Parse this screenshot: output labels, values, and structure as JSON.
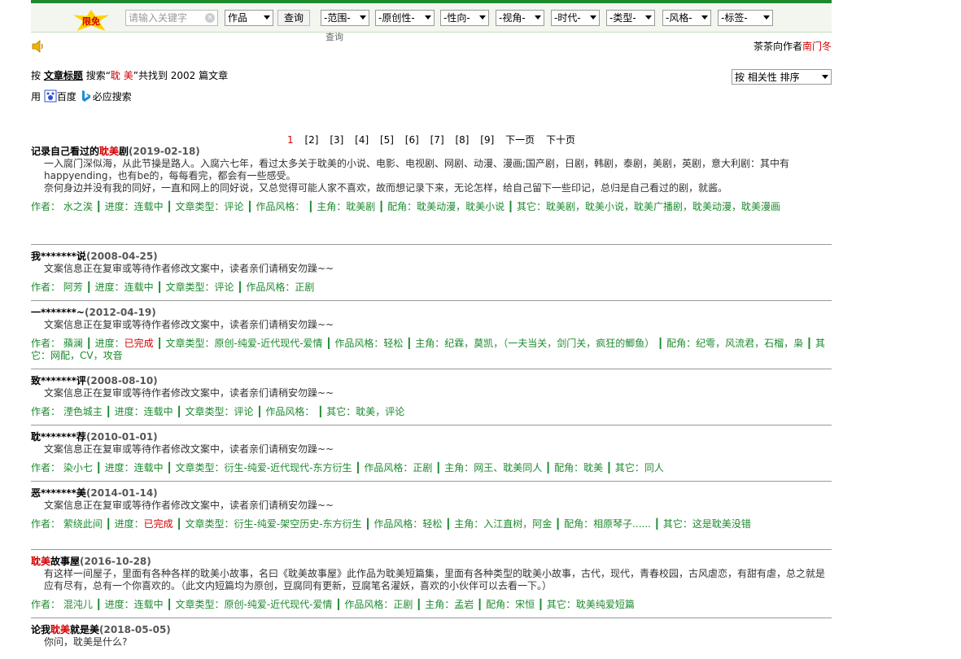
{
  "topbar": {
    "badge_text": "限免",
    "search_placeholder": "请输入关键字",
    "search_clear": "×",
    "type_select": "作品",
    "query_button": "查询",
    "query_label_below": "查询",
    "filters": [
      "-范围-",
      "-原创性-",
      "-性向-",
      "-视角-",
      "-时代-",
      "-类型-",
      "-风格-",
      "-标签-"
    ]
  },
  "author_line": {
    "prefix": "茶茶向作者",
    "name": "南门冬"
  },
  "search_info": {
    "p1": "按",
    "field": "文章标题",
    "p2": "搜索“",
    "keyword": "耽 美",
    "p3": "”共找到",
    "count": "2002",
    "p4": "篇文章"
  },
  "sort_select": "按 相关性 排序",
  "engines": {
    "prefix": "用",
    "baidu": "百度",
    "bing": "必应搜索"
  },
  "pager": {
    "current": "1",
    "pages": [
      "[2]",
      "[3]",
      "[4]",
      "[5]",
      "[6]",
      "[7]",
      "[8]",
      "[9]"
    ],
    "next": "下一页",
    "next10": "下十页"
  },
  "articles": [
    {
      "title_pre": "记录自己看过的",
      "title_hl": "耽美",
      "title_post": "剧",
      "date": "(2019-02-18)",
      "desc": [
        "一入腐门深似海，从此节操是路人。入腐六七年，看过太多关于耽美的小说、电影、电视剧、网剧、动漫、漫画;国产剧，日剧，韩剧，泰剧，美剧，英剧，意大利剧：其中有happyending，也有be的，每每看完，都会有一些感受。",
        "奈何身边并没有我的同好，一直和网上的同好说，又总觉得可能人家不喜欢，故而想记录下来，无论怎样，给自己留下一些印记，总归是自己看过的剧，就酱。"
      ],
      "meta": "作者： 水之涘  ┃ 进度：连载中  ┃ 文章类型：评论  ┃ 作品风格：  ┃ 主角：耽美剧  ┃ 配角：耽美动漫，耽美小说  ┃ 其它：耽美剧，耽美小说，耽美广播剧，耽美动漫，耽美漫画",
      "meta_red": ""
    },
    {
      "title_pre": "我*******说",
      "title_hl": "",
      "title_post": "",
      "date": "(2008-04-25)",
      "desc": [
        "文案信息正在复审或等待作者修改文案中，读者亲们请稍安勿躁~~"
      ],
      "meta": "作者： 阿芳  ┃ 进度：连载中  ┃ 文章类型：评论  ┃ 作品风格：正剧",
      "meta_red": ""
    },
    {
      "title_pre": "一*******~",
      "title_hl": "",
      "title_post": "",
      "date": "(2012-04-19)",
      "desc": [
        "文案信息正在复审或等待作者修改文案中，读者亲们请稍安勿躁~~"
      ],
      "meta_a": "作者： 蘋澜  ┃ 进度：",
      "meta_red": "已完成",
      "meta": "  ┃ 文章类型：原创-纯爱-近代现代-爱情  ┃ 作品风格：轻松  ┃ 主角：纪霖，莫凯，（一夫当关，剑门关，疯狂的鲫鱼）  ┃ 配角：纪雩，风流君，石榴，枭  ┃ 其它：网配，CV，攻音"
    },
    {
      "title_pre": "致*******评",
      "title_hl": "",
      "title_post": "",
      "date": "(2008-08-10)",
      "desc": [
        "文案信息正在复审或等待作者修改文案中，读者亲们请稍安勿躁~~"
      ],
      "meta": "作者： 湮色城主  ┃ 进度：连载中  ┃ 文章类型：评论  ┃ 作品风格：  ┃ 其它：耽美，评论",
      "meta_red": ""
    },
    {
      "title_pre": "耽*******荐",
      "title_hl": "",
      "title_post": "",
      "date": "(2010-01-01)",
      "desc": [
        "文案信息正在复审或等待作者修改文案中，读者亲们请稍安勿躁~~"
      ],
      "meta": "作者： 染小七  ┃ 进度：连载中  ┃ 文章类型：衍生-纯爱-近代现代-东方衍生  ┃ 作品风格：正剧  ┃ 主角：网王、耽美同人  ┃ 配角：耽美  ┃ 其它：同人",
      "meta_red": ""
    },
    {
      "title_pre": "恶*******美",
      "title_hl": "",
      "title_post": "",
      "date": "(2014-01-14)",
      "desc": [
        "文案信息正在复审或等待作者修改文案中，读者亲们请稍安勿躁~~"
      ],
      "meta_a": "作者： 萦绕此间  ┃ 进度：",
      "meta_red": "已完成",
      "meta": "  ┃ 文章类型：衍生-纯爱-架空历史-东方衍生  ┃ 作品风格：轻松  ┃ 主角：入江直树，阿金  ┃ 配角：相原琴子......  ┃ 其它：这是耽美没错"
    },
    {
      "title_pre": "",
      "title_hl": "耽美",
      "title_post": "故事屋",
      "date": "(2016-10-28)",
      "desc": [
        "有这样一间屋子，里面有各种各样的耽美小故事，名曰《耽美故事屋》此作品为耽美短篇集，里面有各种类型的耽美小故事，古代，现代，青春校园，古风虐恋，有甜有虐，总之就是应有尽有，总有一个你喜欢的。（此文内短篇均为原创，豆腐同有更新，豆腐笔名濯妖，喜欢的小伙伴可以去看一下。）"
      ],
      "meta": "作者： 混沌儿  ┃ 进度：连载中  ┃ 文章类型：原创-纯爱-近代现代-爱情  ┃ 作品风格：正剧  ┃ 主角：孟岩  ┃ 配角：宋恒  ┃ 其它：耽美纯爱短篇",
      "meta_red": ""
    },
    {
      "title_pre": "论我",
      "title_hl": "耽美",
      "title_post": "就是美",
      "date": "(2018-05-05)",
      "desc": [
        "你问，耽美是什么?"
      ],
      "meta": "",
      "meta_red": ""
    }
  ]
}
